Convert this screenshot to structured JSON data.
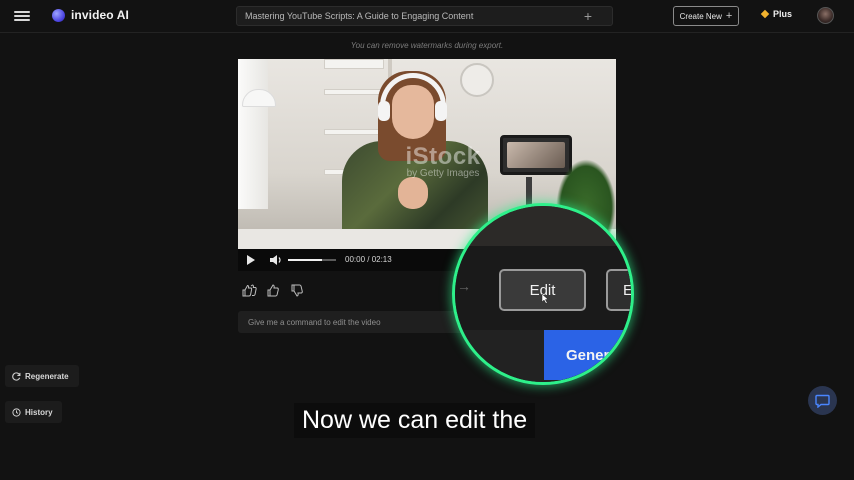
{
  "app": {
    "name": "invideo AI"
  },
  "topbar": {
    "title": "Mastering YouTube Scripts: A Guide to Engaging Content",
    "create_new_label": "Create New",
    "plan_label": "Plus"
  },
  "notice": "You can remove watermarks during export.",
  "video": {
    "watermark_main": "iStock",
    "watermark_sub": "by Getty Images",
    "time_current": "00:00",
    "time_total": "02:13",
    "time_display": "00:00 / 02:13",
    "volume_fraction": 0.7
  },
  "command": {
    "placeholder": "Give me a command to edit the video"
  },
  "sidebar": {
    "regenerate_label": "Regenerate",
    "history_label": "History"
  },
  "magnifier": {
    "edit_label": "Edit",
    "edit_label_partial": "E",
    "generate_label_partial": "Gener"
  },
  "caption": "Now we can edit the",
  "colors": {
    "accent_green": "#2ef08a",
    "generate_blue": "#2b63e6",
    "plus_gold": "#f3b32e",
    "logo_purple": "#4a42e0"
  }
}
